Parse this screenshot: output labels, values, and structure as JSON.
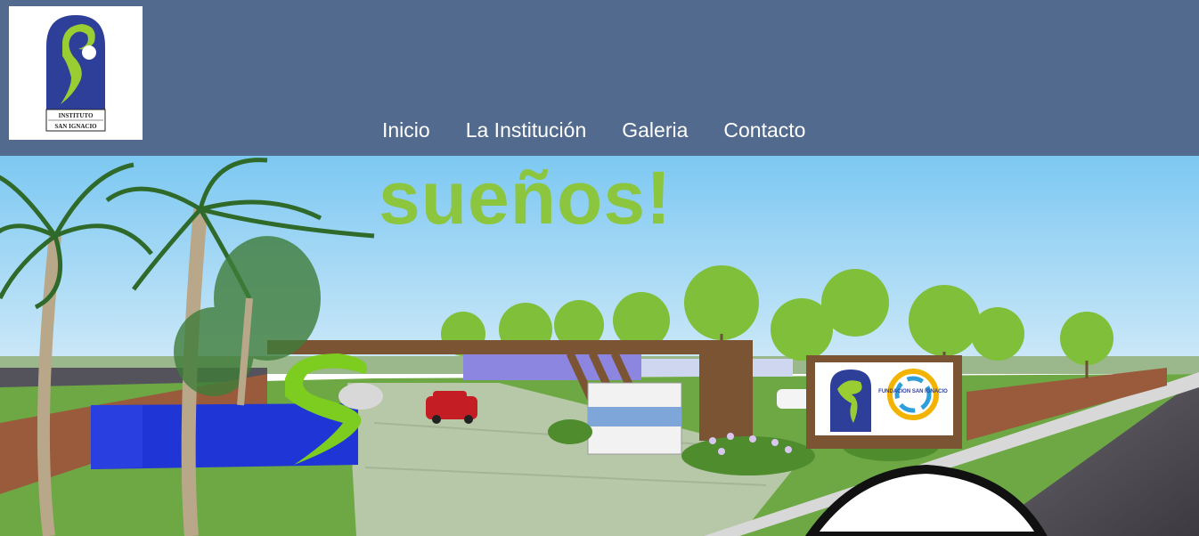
{
  "site": {
    "logo": {
      "alt_name": "instituto-san-ignacio-logo",
      "caption_line1": "INSTITUTO",
      "caption_line2": "SAN IGNACIO"
    }
  },
  "nav": {
    "items": [
      {
        "label": "Inicio"
      },
      {
        "label": "La Institución"
      },
      {
        "label": "Galeria"
      },
      {
        "label": "Contacto"
      }
    ]
  },
  "hero": {
    "headline": "sueños!",
    "sign_text": "FUNDACION SAN IGNACIO"
  },
  "colors": {
    "header_bg": "#526a8e",
    "nav_text": "#ffffff",
    "headline": "#8cc63f",
    "logo_blue": "#2e3f9a",
    "logo_green": "#9acd32"
  }
}
